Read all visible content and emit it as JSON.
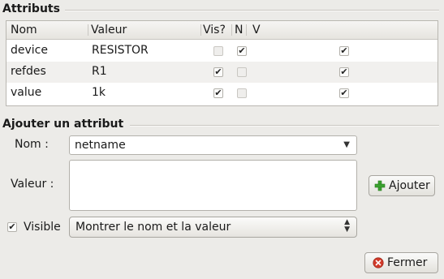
{
  "attributes_section": {
    "title": "Attributs"
  },
  "table": {
    "headers": [
      "Nom",
      "Valeur",
      "Vis?",
      "N",
      "V"
    ],
    "rows": [
      {
        "name": "device",
        "value": "RESISTOR",
        "visible": false,
        "show_name": true,
        "show_value": true
      },
      {
        "name": "refdes",
        "value": "R1",
        "visible": true,
        "show_name": false,
        "show_value": true
      },
      {
        "name": "value",
        "value": "1k",
        "visible": true,
        "show_name": false,
        "show_value": true
      }
    ]
  },
  "add_section": {
    "title": "Ajouter un attribut",
    "name_label": "Nom :",
    "name_value": "netname",
    "value_label": "Valeur :",
    "value_text": "",
    "add_button": "Ajouter",
    "visible_label": "Visible",
    "visible_checked": true,
    "show_mode": "Montrer le nom et la valeur"
  },
  "close_button": "Fermer",
  "colors": {
    "add_icon": "#3aa32f",
    "close_icon": "#d23a2a"
  }
}
